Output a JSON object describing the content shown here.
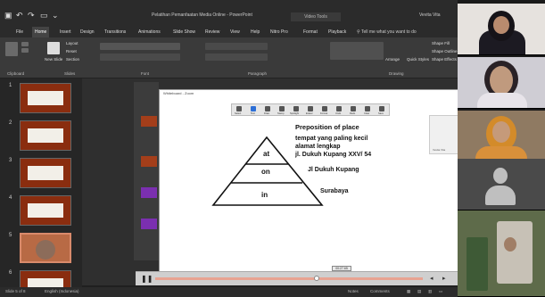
{
  "window": {
    "title": "Pelatihan Pemanfaatan Media Online - PowerPoint",
    "video_tools": "Video Tools",
    "user": "Vevita Vita"
  },
  "tabs": [
    "File",
    "Home",
    "Insert",
    "Design",
    "Transitions",
    "Animations",
    "Slide Show",
    "Review",
    "View",
    "Help",
    "Nitro Pro",
    "Format",
    "Playback"
  ],
  "active_tab": "Home",
  "tell_me": "Tell me what you want to do",
  "ribbon": {
    "clipboard": "Clipboard",
    "slides": "Slides",
    "font": "Font",
    "paragraph": "Paragraph",
    "drawing": "Drawing",
    "new_slide": "New Slide",
    "layout": "Layout",
    "reset": "Reset",
    "section": "Section",
    "arrange": "Arrange",
    "quick_styles": "Quick Styles",
    "shape_fill": "Shape Fill",
    "shape_outline": "Shape Outline",
    "shape_effects": "Shape Effects"
  },
  "slide_numbers": [
    "1",
    "2",
    "3",
    "4",
    "5",
    "6"
  ],
  "whiteboard": {
    "title": "Whiteboard - Zoom",
    "tools": [
      "Select",
      "Text",
      "Draw",
      "Stamp",
      "Spotlight",
      "Eraser",
      "Format",
      "Undo",
      "Redo",
      "Clear",
      "Save"
    ],
    "side_label": "Vevita Vita",
    "heading": "Preposition of place",
    "line1": "tempat yang paling kecil",
    "line2": "alamat lengkap",
    "line3": "jl. Dukuh Kupang XXV/ 54",
    "line4": "Jl Dukuh Kupang",
    "line5": "Surabaya",
    "tri_at": "at",
    "tri_on": "on",
    "tri_in": "in",
    "time": "00:27.65"
  },
  "statusbar": {
    "slide": "Slide 5 of 8",
    "language": "English (Indonesia)",
    "notes": "Notes",
    "comments": "Comments"
  },
  "colors": {
    "accent": "#c43e1c",
    "slide_bg": "#8a2d0f",
    "recording_green": "#2d8a2d"
  }
}
